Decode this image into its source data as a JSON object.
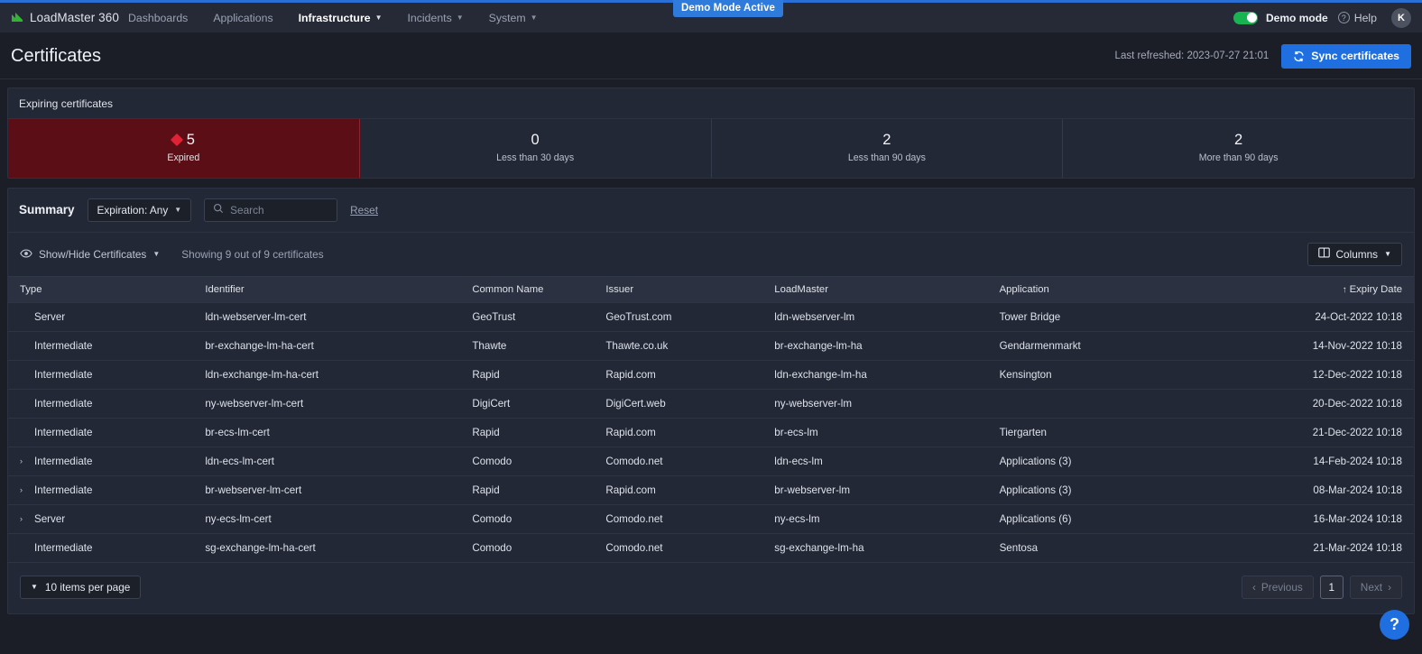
{
  "demo_badge": "Demo Mode Active",
  "navbar": {
    "brand": "LoadMaster 360",
    "items": [
      {
        "label": "Dashboards",
        "has_chevron": false,
        "active": false
      },
      {
        "label": "Applications",
        "has_chevron": false,
        "active": false
      },
      {
        "label": "Infrastructure",
        "has_chevron": true,
        "active": true
      },
      {
        "label": "Incidents",
        "has_chevron": true,
        "active": false
      },
      {
        "label": "System",
        "has_chevron": true,
        "active": false
      }
    ],
    "demo_mode_label": "Demo mode",
    "demo_mode_on": true,
    "help_label": "Help",
    "avatar_initial": "K"
  },
  "header": {
    "title": "Certificates",
    "last_refreshed": "Last refreshed: 2023-07-27 21:01",
    "sync_label": "Sync certificates"
  },
  "expiring": {
    "panel_title": "Expiring certificates",
    "cards": [
      {
        "count": "5",
        "label": "Expired",
        "severity": "expired"
      },
      {
        "count": "0",
        "label": "Less than 30 days",
        "severity": "normal"
      },
      {
        "count": "2",
        "label": "Less than 90 days",
        "severity": "normal"
      },
      {
        "count": "2",
        "label": "More than 90 days",
        "severity": "normal"
      }
    ]
  },
  "summary": {
    "label": "Summary",
    "expiration_filter": "Expiration: Any",
    "search_placeholder": "Search",
    "search_value": "",
    "reset_label": "Reset"
  },
  "toolbar": {
    "showhide_label": "Show/Hide Certificates",
    "showing_text": "Showing 9 out of 9 certificates",
    "columns_label": "Columns"
  },
  "table": {
    "columns": [
      "Type",
      "Identifier",
      "Common Name",
      "Issuer",
      "LoadMaster",
      "Application",
      "Expiry Date"
    ],
    "sorted_column": "Expiry Date",
    "sort_direction": "asc",
    "sort_glyph": "↑",
    "rows": [
      {
        "expandable": false,
        "type": "Server",
        "identifier": "ldn-webserver-lm-cert",
        "common_name": "GeoTrust",
        "issuer": "GeoTrust.com",
        "loadmaster": "ldn-webserver-lm",
        "application": "Tower Bridge",
        "expiry": "24-Oct-2022 10:18"
      },
      {
        "expandable": false,
        "type": "Intermediate",
        "identifier": "br-exchange-lm-ha-cert",
        "common_name": "Thawte",
        "issuer": "Thawte.co.uk",
        "loadmaster": "br-exchange-lm-ha",
        "application": "Gendarmenmarkt",
        "expiry": "14-Nov-2022 10:18"
      },
      {
        "expandable": false,
        "type": "Intermediate",
        "identifier": "ldn-exchange-lm-ha-cert",
        "common_name": "Rapid",
        "issuer": "Rapid.com",
        "loadmaster": "ldn-exchange-lm-ha",
        "application": "Kensington",
        "expiry": "12-Dec-2022 10:18"
      },
      {
        "expandable": false,
        "type": "Intermediate",
        "identifier": "ny-webserver-lm-cert",
        "common_name": "DigiCert",
        "issuer": "DigiCert.web",
        "loadmaster": "ny-webserver-lm",
        "application": "",
        "expiry": "20-Dec-2022 10:18"
      },
      {
        "expandable": false,
        "type": "Intermediate",
        "identifier": "br-ecs-lm-cert",
        "common_name": "Rapid",
        "issuer": "Rapid.com",
        "loadmaster": "br-ecs-lm",
        "application": "Tiergarten",
        "expiry": "21-Dec-2022 10:18"
      },
      {
        "expandable": true,
        "type": "Intermediate",
        "identifier": "ldn-ecs-lm-cert",
        "common_name": "Comodo",
        "issuer": "Comodo.net",
        "loadmaster": "ldn-ecs-lm",
        "application": "Applications (3)",
        "expiry": "14-Feb-2024 10:18"
      },
      {
        "expandable": true,
        "type": "Intermediate",
        "identifier": "br-webserver-lm-cert",
        "common_name": "Rapid",
        "issuer": "Rapid.com",
        "loadmaster": "br-webserver-lm",
        "application": "Applications (3)",
        "expiry": "08-Mar-2024 10:18"
      },
      {
        "expandable": true,
        "type": "Server",
        "identifier": "ny-ecs-lm-cert",
        "common_name": "Comodo",
        "issuer": "Comodo.net",
        "loadmaster": "ny-ecs-lm",
        "application": "Applications (6)",
        "expiry": "16-Mar-2024 10:18"
      },
      {
        "expandable": false,
        "type": "Intermediate",
        "identifier": "sg-exchange-lm-ha-cert",
        "common_name": "Comodo",
        "issuer": "Comodo.net",
        "loadmaster": "sg-exchange-lm-ha",
        "application": "Sentosa",
        "expiry": "21-Mar-2024 10:18"
      }
    ]
  },
  "footer": {
    "per_page_label": "10 items per page",
    "previous_label": "Previous",
    "current_page": "1",
    "next_label": "Next"
  },
  "help_fab": "?",
  "colors": {
    "accent_blue": "#1f6fe0",
    "expired_bg": "#5c0e16",
    "expired_marker": "#e02234",
    "toggle_on": "#18b451",
    "page_bg": "#1b1e27",
    "panel_bg": "#232836"
  }
}
